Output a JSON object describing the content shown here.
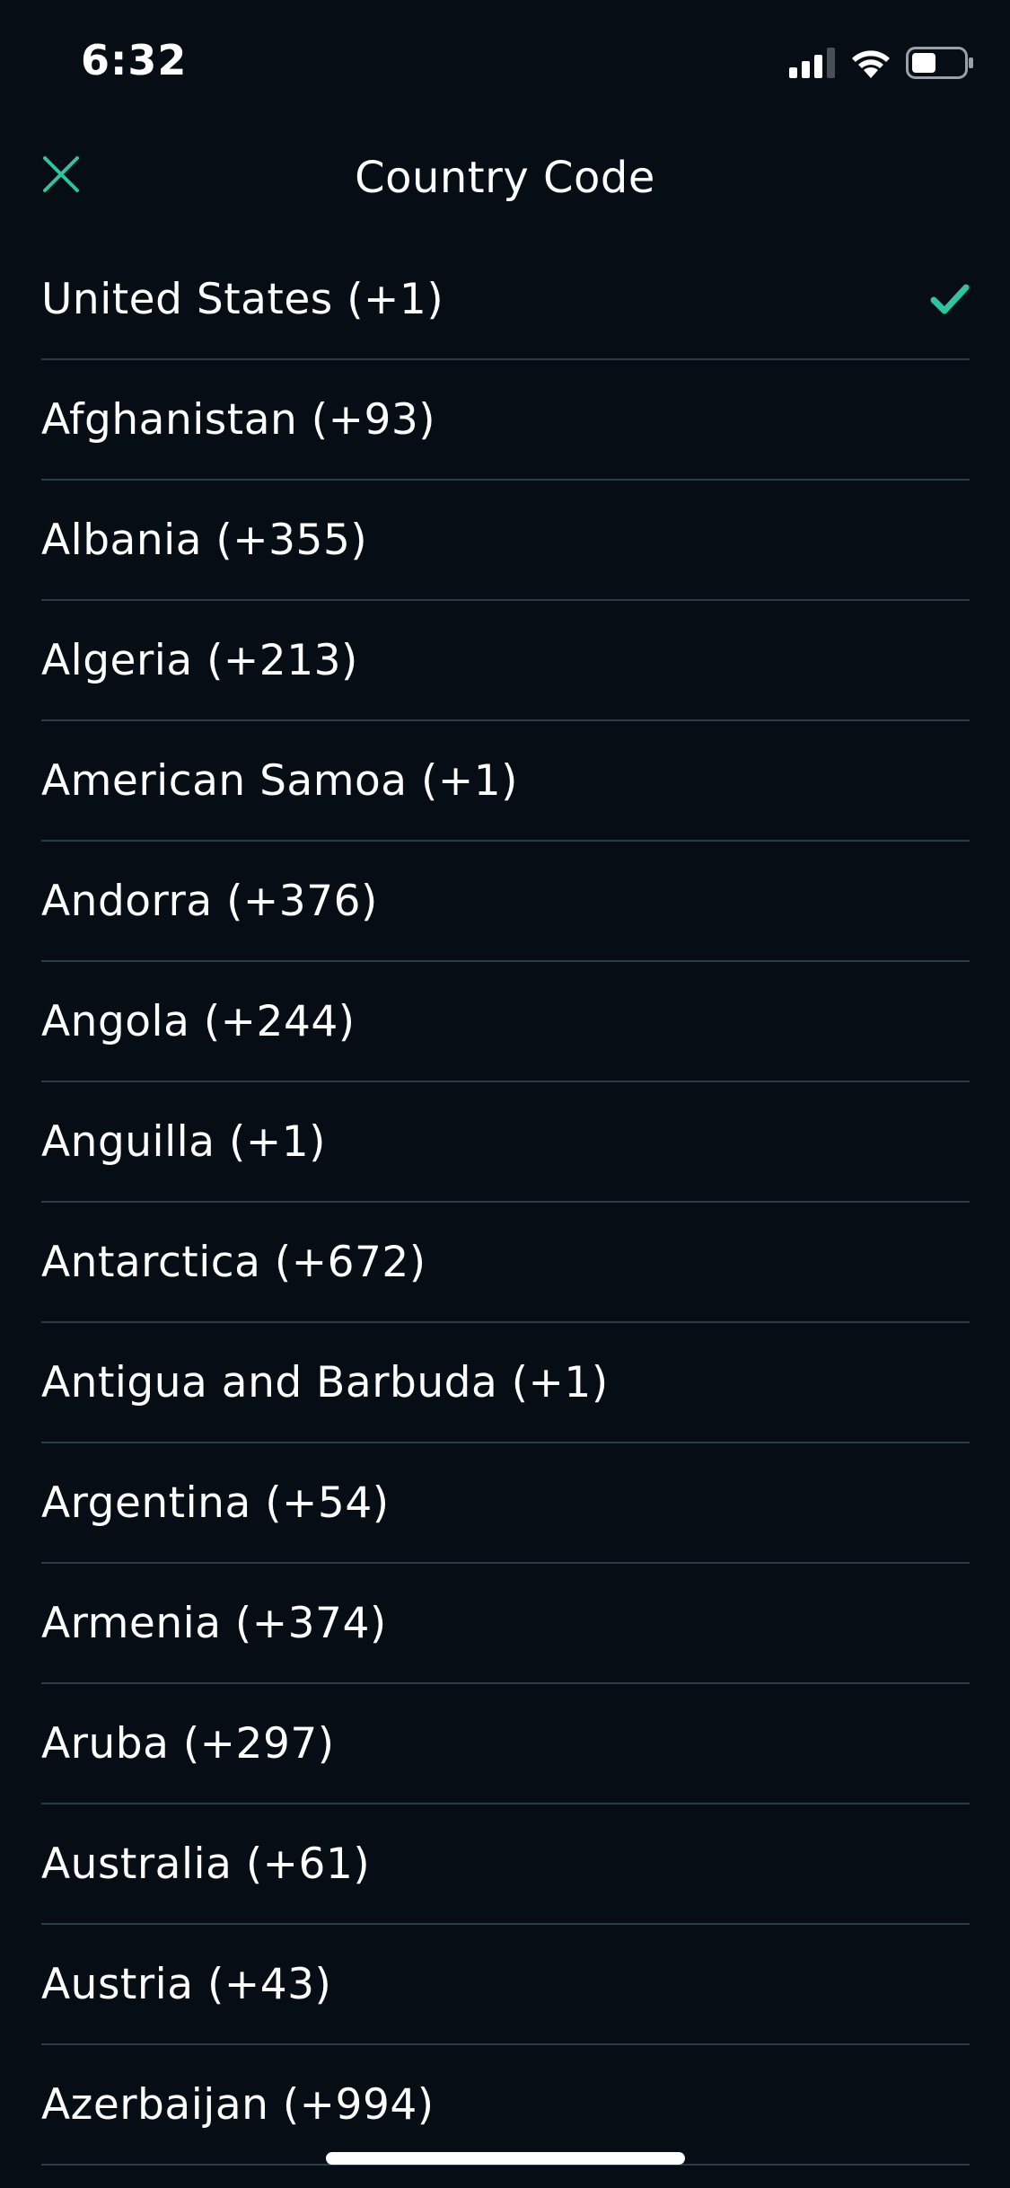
{
  "status_bar": {
    "time": "6:32",
    "icons": [
      "cellular-signal-icon",
      "wifi-icon",
      "battery-icon"
    ]
  },
  "header": {
    "title": "Country Code",
    "close_icon": "close-icon"
  },
  "colors": {
    "background": "#070d14",
    "accent": "#2ec4a0",
    "divider": "#2a3a44",
    "text": "#ffffff"
  },
  "countries": [
    {
      "label": "United States (+1)",
      "selected": true
    },
    {
      "label": "Afghanistan (+93)",
      "selected": false
    },
    {
      "label": "Albania (+355)",
      "selected": false
    },
    {
      "label": "Algeria (+213)",
      "selected": false
    },
    {
      "label": "American Samoa (+1)",
      "selected": false
    },
    {
      "label": "Andorra (+376)",
      "selected": false
    },
    {
      "label": "Angola (+244)",
      "selected": false
    },
    {
      "label": "Anguilla (+1)",
      "selected": false
    },
    {
      "label": "Antarctica (+672)",
      "selected": false
    },
    {
      "label": "Antigua and Barbuda (+1)",
      "selected": false
    },
    {
      "label": "Argentina (+54)",
      "selected": false
    },
    {
      "label": "Armenia (+374)",
      "selected": false
    },
    {
      "label": "Aruba (+297)",
      "selected": false
    },
    {
      "label": "Australia (+61)",
      "selected": false
    },
    {
      "label": "Austria (+43)",
      "selected": false
    },
    {
      "label": "Azerbaijan (+994)",
      "selected": false
    }
  ]
}
